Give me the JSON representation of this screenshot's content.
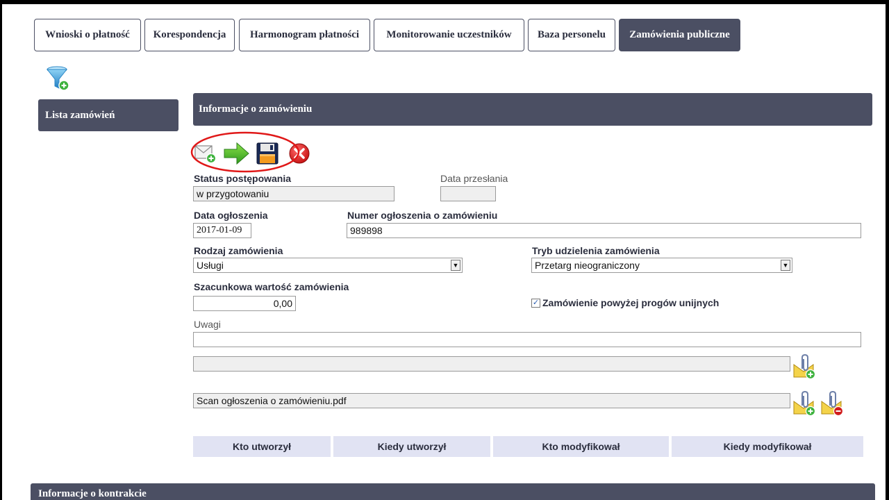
{
  "tabs": [
    {
      "label": "Wnioski o płatność",
      "active": false
    },
    {
      "label": "Korespondencja",
      "active": false
    },
    {
      "label": "Harmonogram płatności",
      "active": false
    },
    {
      "label": "Monitorowanie uczestników",
      "active": false
    },
    {
      "label": "Baza personelu",
      "active": false
    },
    {
      "label": "Zamówienia publiczne",
      "active": true
    }
  ],
  "sidebar": {
    "lista_label": "Lista zamówień"
  },
  "section": {
    "title": "Informacje o zamówieniu",
    "bottom_title": "Informacje o kontrakcie"
  },
  "toolbar": {
    "icons": [
      "send-mail-icon",
      "arrow-right-icon",
      "save-icon",
      "delete-icon"
    ]
  },
  "form": {
    "status_label": "Status postępowania",
    "status_value": "w przygotowaniu",
    "data_przeslania_label": "Data przesłania",
    "data_przeslania_value": "",
    "data_ogloszenia_label": "Data ogłoszenia",
    "data_ogloszenia_value": "2017-01-09",
    "numer_label": "Numer ogłoszenia o zamówieniu",
    "numer_value": "989898",
    "rodzaj_label": "Rodzaj zamówienia",
    "rodzaj_value": "Usługi",
    "tryb_label": "Tryb udzielenia zamówienia",
    "tryb_value": "Przetarg nieograniczony",
    "wartosc_label": "Szacunkowa wartość zamówienia",
    "wartosc_value": "0,00",
    "progi_label": "Zamówienie powyżej progów unijnych",
    "progi_checked": true,
    "uwagi_label": "Uwagi",
    "uwagi_value": "",
    "attachment_empty": "",
    "attachment_file": "Scan ogłoszenia o zamówieniu.pdf"
  },
  "footer": {
    "kto_utworzyl": "Kto utworzył",
    "kiedy_utworzyl": "Kiedy utworzył",
    "kto_modyfikowal": "Kto modyfikował",
    "kiedy_modyfikowal": "Kiedy modyfikował"
  },
  "colors": {
    "header": "#4b4f63",
    "highlight_ring": "#e01818",
    "footer_bg": "#e1e3f3"
  }
}
